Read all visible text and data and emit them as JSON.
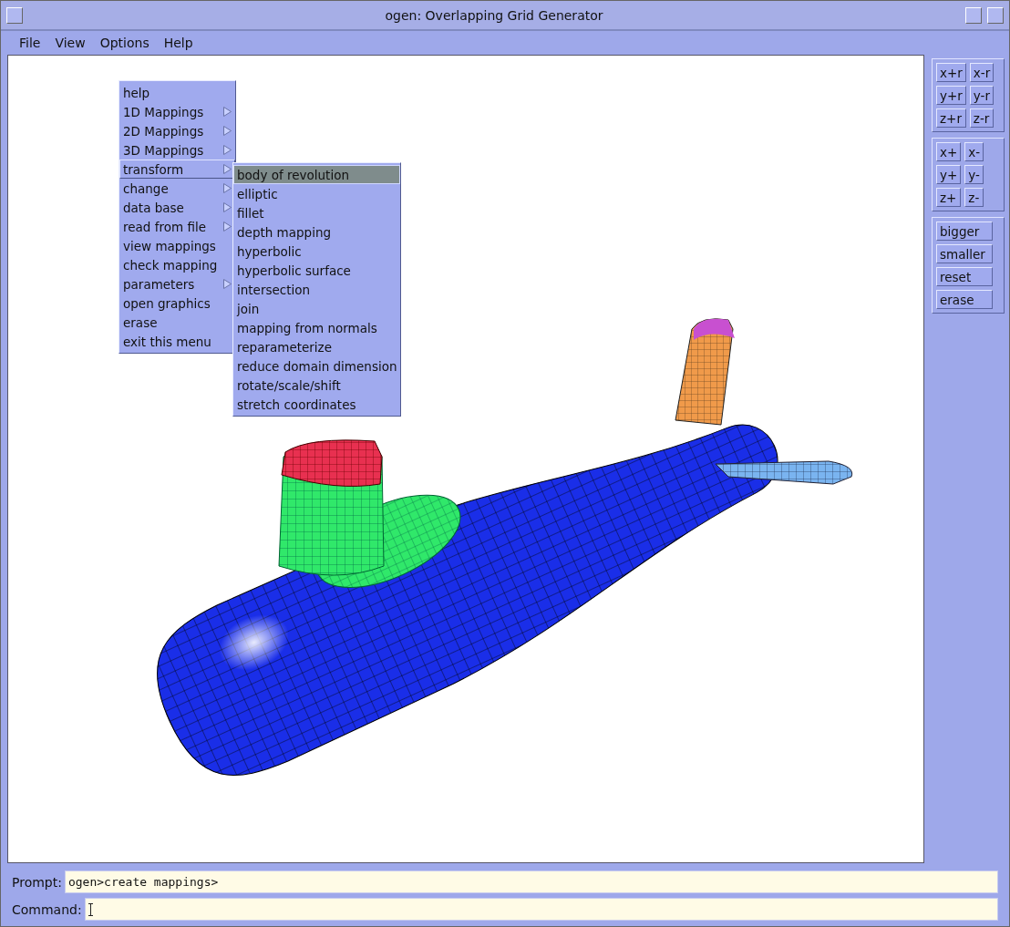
{
  "window": {
    "title": "ogen: Overlapping Grid Generator"
  },
  "menubar": [
    "File",
    "View",
    "Options",
    "Help"
  ],
  "main_menu": {
    "items": [
      {
        "label": "help",
        "submenu": false,
        "selected": false
      },
      {
        "label": "1D Mappings",
        "submenu": true,
        "selected": false
      },
      {
        "label": "2D Mappings",
        "submenu": true,
        "selected": false
      },
      {
        "label": "3D Mappings",
        "submenu": true,
        "selected": false
      },
      {
        "label": "transform",
        "submenu": true,
        "selected": true
      },
      {
        "label": "change",
        "submenu": true,
        "selected": false
      },
      {
        "label": "data base",
        "submenu": true,
        "selected": false
      },
      {
        "label": "read from file",
        "submenu": true,
        "selected": false
      },
      {
        "label": "view mappings",
        "submenu": false,
        "selected": false
      },
      {
        "label": "check mapping",
        "submenu": false,
        "selected": false
      },
      {
        "label": "parameters",
        "submenu": true,
        "selected": false
      },
      {
        "label": "open graphics",
        "submenu": false,
        "selected": false
      },
      {
        "label": "erase",
        "submenu": false,
        "selected": false
      },
      {
        "label": "exit this menu",
        "submenu": false,
        "selected": false
      }
    ]
  },
  "sub_menu": {
    "items": [
      {
        "label": "body of revolution",
        "selected": true
      },
      {
        "label": "elliptic",
        "selected": false
      },
      {
        "label": "fillet",
        "selected": false
      },
      {
        "label": "depth mapping",
        "selected": false
      },
      {
        "label": "hyperbolic",
        "selected": false
      },
      {
        "label": "hyperbolic surface",
        "selected": false
      },
      {
        "label": "intersection",
        "selected": false
      },
      {
        "label": "join",
        "selected": false
      },
      {
        "label": "mapping from normals",
        "selected": false
      },
      {
        "label": "reparameterize",
        "selected": false
      },
      {
        "label": "reduce domain dimension",
        "selected": false
      },
      {
        "label": "rotate/scale/shift",
        "selected": false
      },
      {
        "label": "stretch coordinates",
        "selected": false
      }
    ]
  },
  "view_panel": {
    "groups": [
      {
        "kind": "grid",
        "buttons": [
          "x+r",
          "x-r",
          "y+r",
          "y-r",
          "z+r",
          "z-r"
        ]
      },
      {
        "kind": "grid",
        "buttons": [
          "x+",
          "x-",
          "y+",
          "y-",
          "z+",
          "z-"
        ]
      },
      {
        "kind": "column",
        "buttons": [
          "bigger",
          "smaller",
          "reset",
          "erase"
        ]
      }
    ]
  },
  "prompt": {
    "label": "Prompt:",
    "value": "ogen>create mappings>"
  },
  "command": {
    "label": "Command:"
  }
}
